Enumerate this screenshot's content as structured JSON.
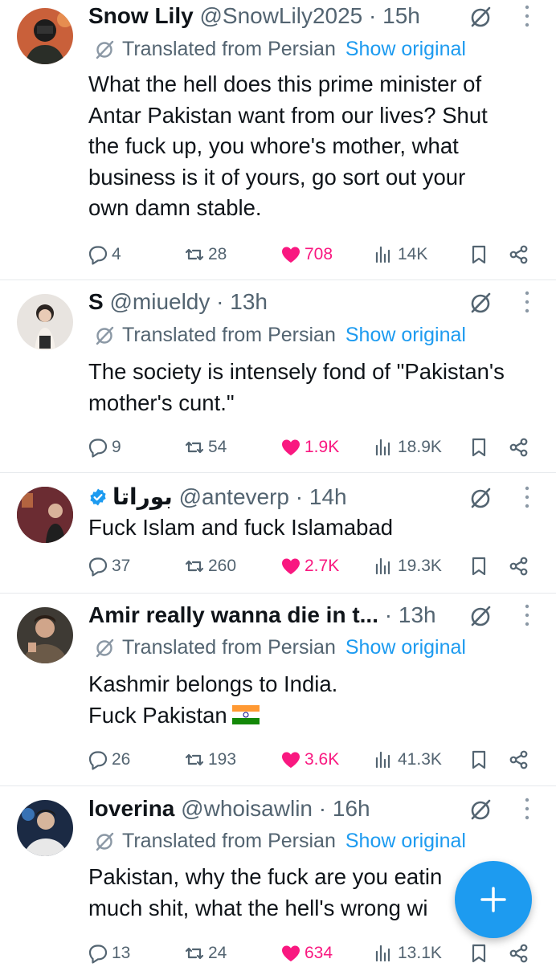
{
  "tweets": [
    {
      "name": "Snow Lily",
      "handle": "@SnowLily2025",
      "time": "· 15h",
      "verified": false,
      "translated": true,
      "translated_label": "Translated from Persian",
      "show_original": "Show original",
      "body": "What the hell does this prime minister of\nAntar Pakistan want from our lives? Shut\nthe fuck up, you whore's mother, what\nbusiness is it of yours, go sort out your\nown damn stable.",
      "replies": "4",
      "reposts": "28",
      "likes": "708",
      "views": "14K",
      "avatar_bg": "#c9603a"
    },
    {
      "name": "S",
      "handle": "@miueldy",
      "time": "· 13h",
      "verified": false,
      "translated": true,
      "translated_label": "Translated from Persian",
      "show_original": "Show original",
      "body": "The society is intensely fond of \"Pakistan's\nmother's cunt.\"",
      "replies": "9",
      "reposts": "54",
      "likes": "1.9K",
      "views": "18.9K",
      "avatar_bg": "#e8e4e0"
    },
    {
      "name": "بوراتا",
      "handle": "@anteverp",
      "time": "· 14h",
      "verified": true,
      "translated": false,
      "body": "Fuck Islam and fuck Islamabad",
      "replies": "37",
      "reposts": "260",
      "likes": "2.7K",
      "views": "19.3K",
      "avatar_bg": "#5a2a2a"
    },
    {
      "name": "Amir really wanna die in t...",
      "handle": "",
      "time": "· 13h",
      "verified": false,
      "translated": true,
      "translated_label": "Translated from Persian",
      "show_original": "Show original",
      "body": "Kashmir belongs to India.\nFuck Pakistan",
      "flag": "India flag",
      "replies": "26",
      "reposts": "193",
      "likes": "3.6K",
      "views": "41.3K",
      "avatar_bg": "#3e3a34"
    },
    {
      "name": "loverina",
      "handle": "@whoisawlin",
      "time": "· 16h",
      "verified": false,
      "translated": true,
      "translated_label": "Translated from Persian",
      "show_original": "Show original",
      "body": "Pakistan, why the fuck are you eatin\nmuch shit, what the hell's wrong wi",
      "replies": "13",
      "reposts": "24",
      "likes": "634",
      "views": "13.1K",
      "avatar_bg": "#1b2a44"
    }
  ],
  "icons": {
    "reply": "reply-icon",
    "repost": "repost-icon",
    "like": "heart-icon",
    "views": "views-icon",
    "bookmark": "bookmark-icon",
    "share": "share-icon",
    "grok": "grok-icon",
    "more": "more-icon",
    "translate": "translate-icon",
    "compose": "compose-plus-icon"
  },
  "colors": {
    "accent": "#1d9bf0",
    "like": "#f91880",
    "secondary": "#536471",
    "text": "#0f1419"
  }
}
